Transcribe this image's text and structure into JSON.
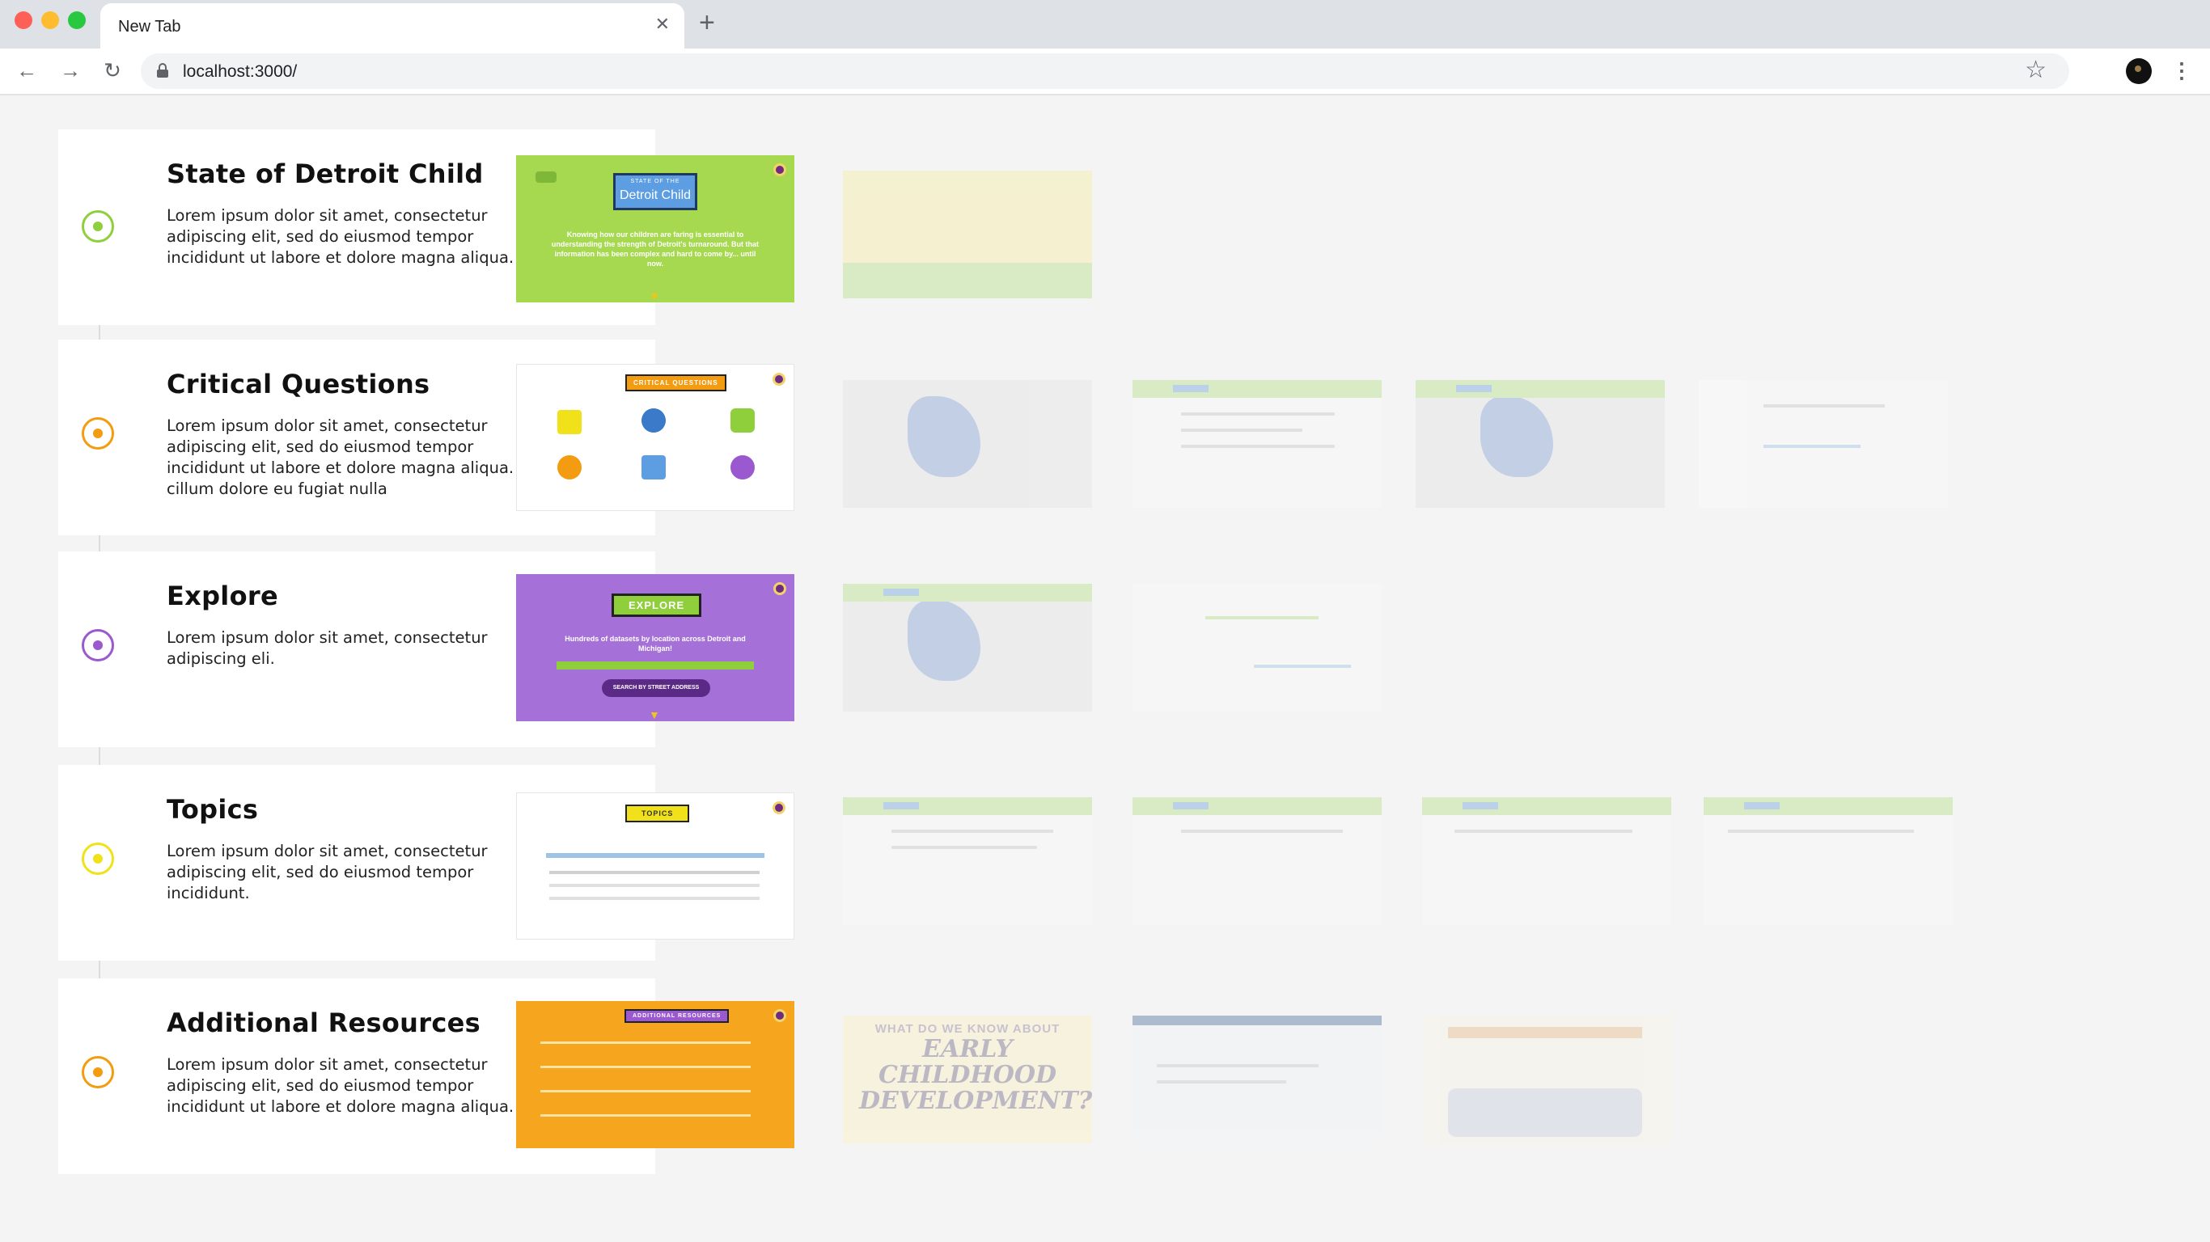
{
  "browser": {
    "tab_title": "New Tab",
    "tab_close": "✕",
    "new_tab": "+",
    "url": "localhost:3000/",
    "back": "←",
    "forward": "→",
    "reload": "↻",
    "bookmark": "☆",
    "menu": "⋮"
  },
  "sections": [
    {
      "title": "State of Detroit Child",
      "description": "Lorem ipsum dolor sit amet, consectetur adipiscing elit, sed do eiusmod tempor incididunt ut labore et dolore magna aliqua.",
      "color": "#8fcf3c",
      "preview": {
        "label_top": "STATE OF THE",
        "label": "Detroit Child",
        "text": "Knowing how our children are faring is essential to understanding the strength of Detroit's turnaround. But that information has been complex and hard to come by... until now."
      }
    },
    {
      "title": "Critical Questions",
      "description": "Lorem ipsum dolor sit amet, consectetur adipiscing elit, sed do eiusmod tempor incididunt ut labore et dolore magna aliqua. cillum dolore eu fugiat nulla",
      "color": "#f39c12",
      "preview": {
        "label": "CRITICAL QUESTIONS"
      }
    },
    {
      "title": "Explore",
      "description": "Lorem ipsum dolor sit amet, consectetur adipiscing eli.",
      "color": "#9b59d0",
      "preview": {
        "label": "EXPLORE",
        "text": "Hundreds of datasets by location across Detroit and Michigan!",
        "button": "SEARCH BY STREET ADDRESS"
      }
    },
    {
      "title": "Topics",
      "description": "Lorem ipsum dolor sit amet, consectetur adipiscing elit, sed do eiusmod tempor incididunt.",
      "color": "#f1e11a",
      "preview": {
        "label": "TOPICS"
      }
    },
    {
      "title": "Additional Resources",
      "description": "Lorem ipsum dolor sit amet, consectetur adipiscing elit, sed do eiusmod tempor incididunt ut labore et dolore magna aliqua.",
      "color": "#f39c12",
      "preview": {
        "label": "ADDITIONAL RESOURCES"
      }
    }
  ],
  "thumbnails": {
    "resources_1_title": "WHAT DO WE KNOW ABOUT",
    "resources_1_big": "EARLY CHILDHOOD DEVELOPMENT?"
  }
}
